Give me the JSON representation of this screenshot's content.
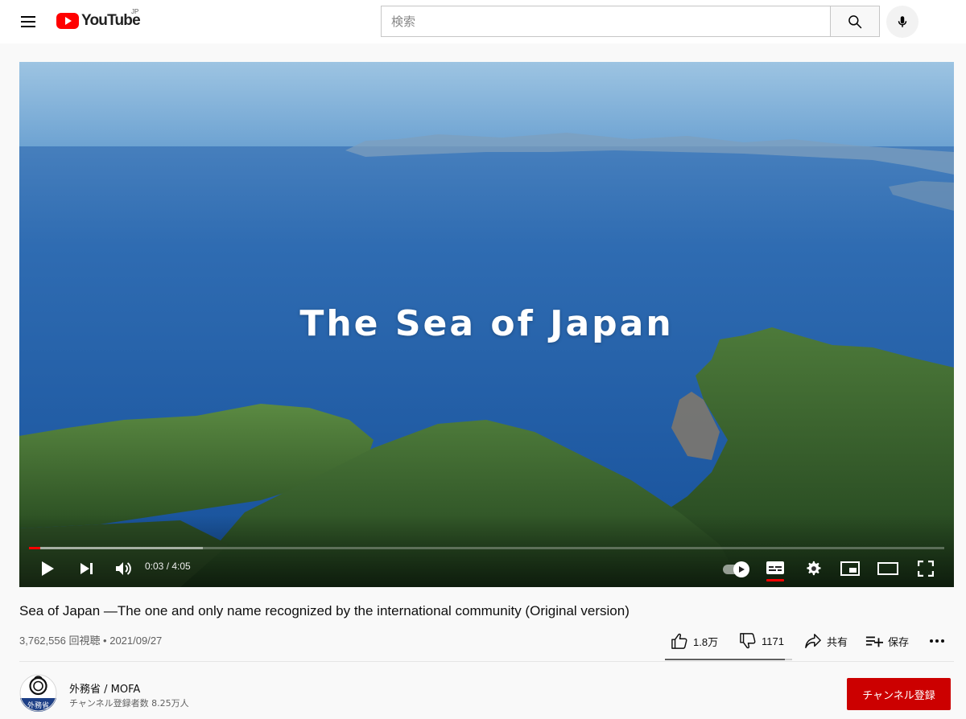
{
  "header": {
    "logo_text": "YouTube",
    "region_code": "JP",
    "search_placeholder": "検索",
    "search_value": ""
  },
  "player": {
    "overlay_title": "The Sea of Japan",
    "current_time": "0:03",
    "duration": "4:05",
    "time_display": "0:03 / 4:05",
    "progress_fraction": 0.012,
    "buffered_fraction": 0.19,
    "accent_color": "#ff0000",
    "controls": [
      "play-icon",
      "next-icon",
      "volume-icon",
      "autoplay-toggle",
      "subtitles-icon",
      "settings-icon",
      "miniplayer-icon",
      "theater-icon",
      "fullscreen-icon"
    ]
  },
  "video": {
    "title": "Sea of Japan ―The one and only name recognized by the international community (Original version)",
    "views": "3,762,556 回視聴",
    "date": "2021/09/27",
    "meta": "3,762,556 回視聴 • 2021/09/27"
  },
  "actions": {
    "like_count": "1.8万",
    "dislike_count": "1171",
    "share_label": "共有",
    "save_label": "保存",
    "like_fraction": 0.94
  },
  "channel": {
    "name": "外務省 / MOFA",
    "subscribers": "チャンネル登録者数 8.25万人",
    "avatar_label": "外務省",
    "subscribe_label": "チャンネル登録",
    "subscribe_color": "#cc0000"
  }
}
